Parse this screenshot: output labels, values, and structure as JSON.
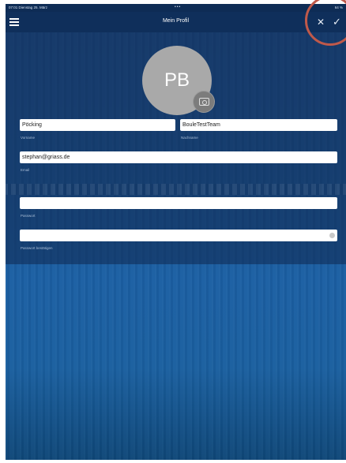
{
  "status_bar": {
    "time": "07:01  Dienstag 25. März",
    "dots": "•••",
    "battery": "64 %"
  },
  "nav": {
    "title": "Mein Profil",
    "menu_icon": "hamburger-menu-icon",
    "close_icon": "close-icon",
    "save_icon": "checkmark-icon"
  },
  "profile": {
    "initials": "PB",
    "camera_icon": "camera-icon"
  },
  "form": {
    "first_name": {
      "value": "Pöcking",
      "label": "Vorname"
    },
    "last_name": {
      "value": "BouleTestTeam",
      "label": "Nachname"
    },
    "email": {
      "value": "stephan@griass.de",
      "label": "Email"
    },
    "password": {
      "value": "",
      "label": "Passwort"
    },
    "password_confirm": {
      "value": "",
      "label": "Passwort bestätigen"
    }
  },
  "colors": {
    "nav_background": "#0f2f5b",
    "avatar": "#a9a9a9",
    "highlight_circle": "#c0594a"
  }
}
